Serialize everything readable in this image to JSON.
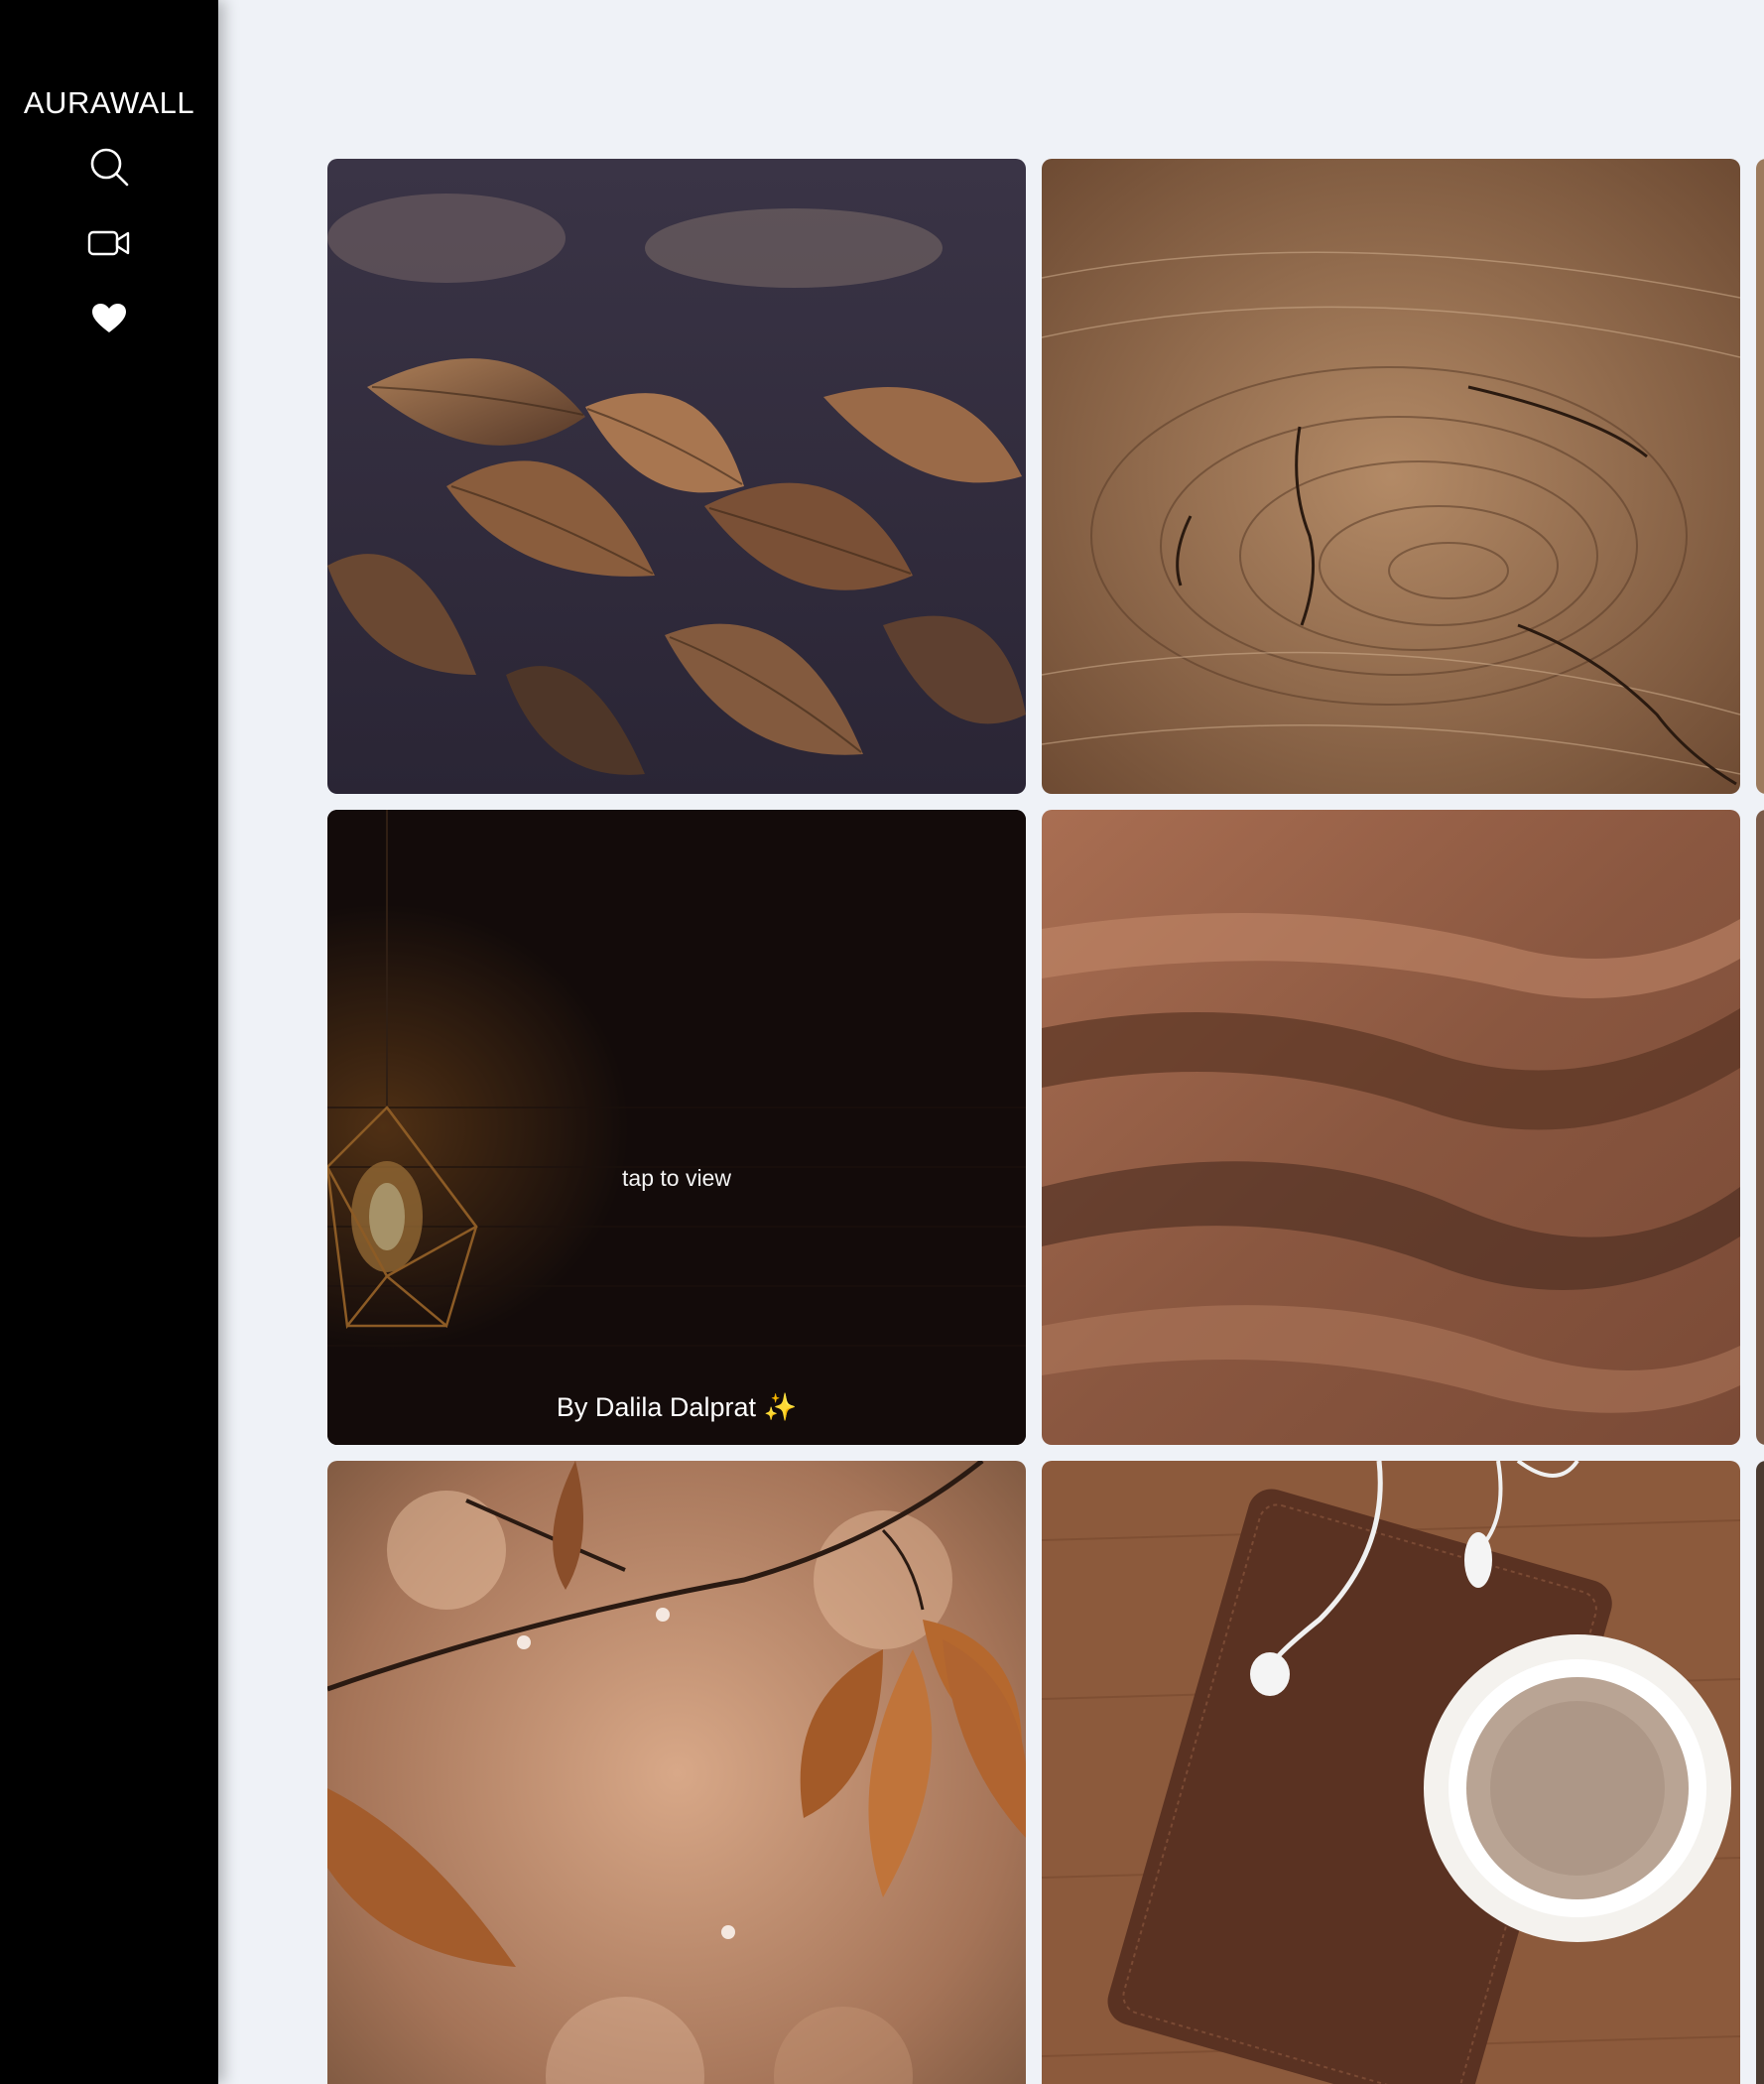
{
  "app": {
    "brand": "AURAWALL"
  },
  "nav": [
    {
      "id": "search",
      "icon": "search-icon"
    },
    {
      "id": "videos",
      "icon": "video-icon"
    },
    {
      "id": "favorites",
      "icon": "heart-icon"
    }
  ],
  "gallery": {
    "items": [
      {
        "subject": "dark brown leaves"
      },
      {
        "subject": "cracked wood grain"
      },
      {
        "subject": "partial image"
      },
      {
        "subject": "hanging geometric lamp",
        "hover_text": "tap to view",
        "author": "By Dalila Dalprat",
        "author_suffix": "✨"
      },
      {
        "subject": "brown satin fabric"
      },
      {
        "subject": "partial image"
      },
      {
        "subject": "autumn leaves on branch"
      },
      {
        "subject": "notebook, earphones and coffee"
      },
      {
        "subject": "partial image"
      }
    ]
  },
  "colors": {
    "sidebar": "#000000",
    "background": "#eff2f7",
    "accent_text": "#ffffff"
  }
}
